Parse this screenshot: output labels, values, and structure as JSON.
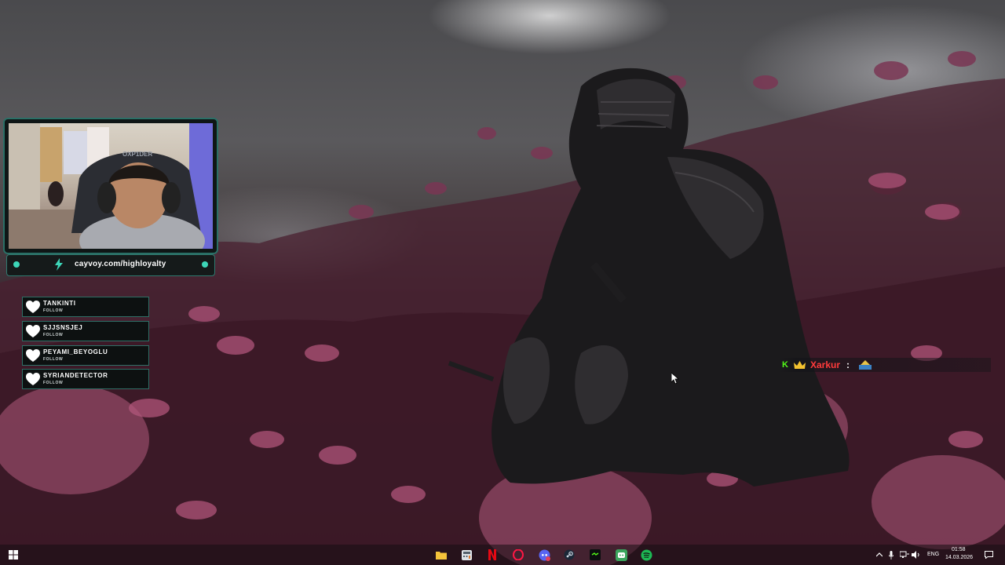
{
  "webcam": {
    "url_text": "cayvoy.com/highloyalty",
    "chair_brand": "OXP1DER"
  },
  "followers": [
    {
      "name": "TANKINTI",
      "label": "FOLLOW"
    },
    {
      "name": "SJJSNSJEJ",
      "label": "FOLLOW"
    },
    {
      "name": "PEYAMI_BEYOGLU",
      "label": "FOLLOW"
    },
    {
      "name": "SYRIANDETECTOR",
      "label": "FOLLOW"
    }
  ],
  "chat": {
    "username": "Xarkur",
    "separator": ":"
  },
  "taskbar": {
    "apps": [
      "file-explorer",
      "calculator",
      "netflix",
      "opera-gx",
      "discord-ptb",
      "steam",
      "kick",
      "discord",
      "spotify"
    ],
    "tray": {
      "language": "ENG",
      "time": "01:58",
      "date": "14.03.2026"
    }
  },
  "colors": {
    "accent_teal": "#2f7a70",
    "kick_green": "#53fc18",
    "chat_name": "#ff3b3b"
  }
}
